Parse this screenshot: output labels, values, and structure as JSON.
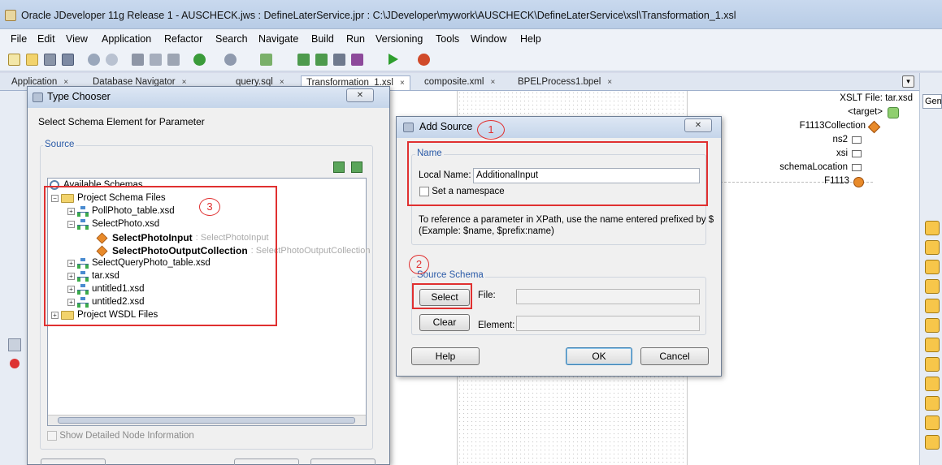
{
  "window": {
    "title": "Oracle JDeveloper 11g Release 1 - AUSCHECK.jws : DefineLaterService.jpr : C:\\JDeveloper\\mywork\\AUSCHECK\\DefineLaterService\\xsl\\Transformation_1.xsl"
  },
  "menu": [
    "File",
    "Edit",
    "View",
    "Application",
    "Refactor",
    "Search",
    "Navigate",
    "Build",
    "Run",
    "Versioning",
    "Tools",
    "Window",
    "Help"
  ],
  "editor_tabs": [
    {
      "label": "Application",
      "close": "×"
    },
    {
      "label": "Database Navigator",
      "close": "×"
    },
    {
      "label": "query.sql",
      "close": "×"
    },
    {
      "label": "Transformation_1.xsl",
      "close": "×"
    },
    {
      "label": "composite.xml",
      "close": "×"
    },
    {
      "label": "BPELProcess1.bpel",
      "close": "×"
    }
  ],
  "right_panel": {
    "tab_label": "Gen"
  },
  "xslt": {
    "file_label": "XSLT File: tar.xsd",
    "nodes": [
      "<target>",
      "F1113Collection",
      "ns2",
      "xsi",
      "schemaLocation",
      "F1113"
    ]
  },
  "type_chooser": {
    "title": "Type Chooser",
    "instruction": "Select Schema Element for Parameter",
    "group_label": "Source",
    "root": "Available Schemas",
    "tree": [
      {
        "label": "Project Schema Files"
      },
      {
        "label": "PollPhoto_table.xsd"
      },
      {
        "label": "SelectPhoto.xsd"
      },
      {
        "label": "SelectPhotoInput",
        "type": "SelectPhotoInput"
      },
      {
        "label": "SelectPhotoOutputCollection",
        "type": "SelectPhotoOutputCollection"
      },
      {
        "label": "SelectQueryPhoto_table.xsd"
      },
      {
        "label": "tar.xsd"
      },
      {
        "label": "untitled1.xsd"
      },
      {
        "label": "untitled2.xsd"
      },
      {
        "label": "Project WSDL Files"
      }
    ],
    "show_detail_label": "Show Detailed Node Information",
    "annotation": "3"
  },
  "add_source": {
    "title": "Add Source",
    "annotation_1": "1",
    "annotation_2": "2",
    "name_group": "Name",
    "local_name_label": "Local Name:",
    "local_name_value": "AdditionalInput",
    "namespace_label": "Set a namespace",
    "info_line1": "To reference a parameter in XPath, use the name entered prefixed by $",
    "info_line2": "(Example: $name, $prefix:name)",
    "schema_group": "Source Schema",
    "select_button": "Select",
    "clear_button": "Clear",
    "file_label": "File:",
    "element_label": "Element:",
    "help_button": "Help",
    "ok_button": "OK",
    "cancel_button": "Cancel"
  },
  "colors": {
    "annotation": "#e03030",
    "group_label": "#2b5ba8"
  }
}
